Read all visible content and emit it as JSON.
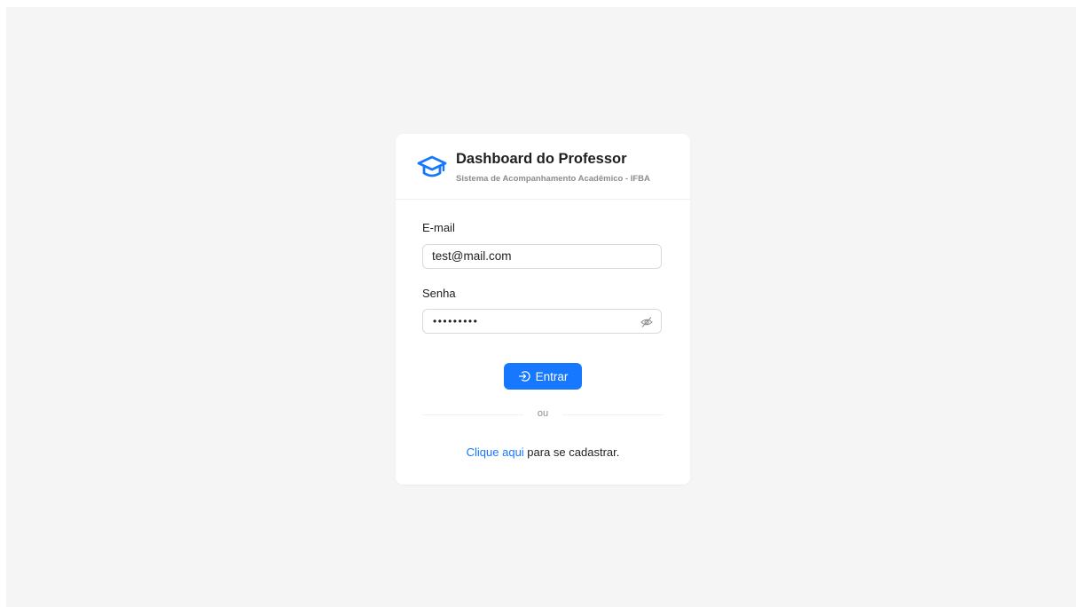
{
  "header": {
    "icon": "graduation-cap-icon",
    "title": "Dashboard do Professor",
    "subtitle": "Sistema de Acompanhamento Acadêmico - IFBA"
  },
  "form": {
    "email": {
      "label": "E-mail",
      "value": "test@mail.com"
    },
    "password": {
      "label": "Senha",
      "masked_value": "•••••••••",
      "toggle_icon": "eye-invisible-icon"
    },
    "submit": {
      "icon": "login-icon",
      "label": "Entrar"
    }
  },
  "divider": {
    "text": "ou"
  },
  "signup": {
    "link_text": "Clique aqui",
    "rest_text": " para se cadastrar."
  },
  "colors": {
    "primary": "#1677ff",
    "background": "#f5f5f5",
    "card": "#ffffff",
    "muted_text": "#8c8c8c"
  }
}
